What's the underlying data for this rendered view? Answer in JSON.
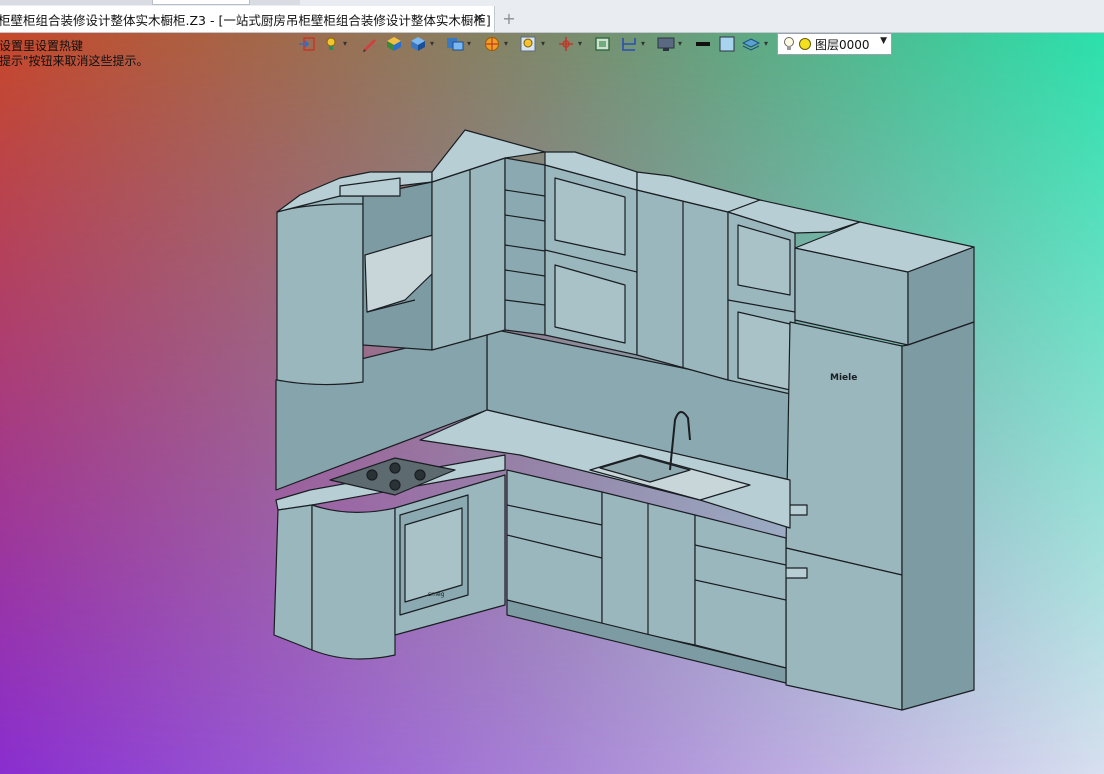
{
  "window": {
    "tab_title": "柜壁柜组合装修设计整体实木橱柜.Z3 - [一站式厨房吊柜壁柜组合装修设计整体实木橱柜]",
    "close_label": "✕",
    "new_tab_label": "+"
  },
  "hints": {
    "line1": "设置里设置热键",
    "line2": "提示\"按钮来取消这些提示。"
  },
  "toolbar": {
    "icons": [
      "exit-icon",
      "light-icon",
      "pen-icon",
      "solid-cube-icon",
      "view-cube-icon",
      "display-mode-icon",
      "render-icon",
      "zoom-fit-icon",
      "axis-icon",
      "frame-icon",
      "section-icon",
      "monitor-icon",
      "black-swatch-icon",
      "blue-swatch-icon",
      "layers-icon"
    ],
    "layer": {
      "name": "图层0000",
      "bulb_icon": "bulb-icon",
      "status_color": "#f3e020"
    }
  },
  "model": {
    "logo": "Miele",
    "oven_label": "smeg"
  },
  "colors": {
    "background_top_left": "#c94a22",
    "background_top_right": "#22e0a8",
    "background_bottom_left": "#8a2ed0",
    "background_bottom_right": "#d8e0f0",
    "model_fill": "#9bb7be",
    "model_edge": "#1a1e22"
  }
}
